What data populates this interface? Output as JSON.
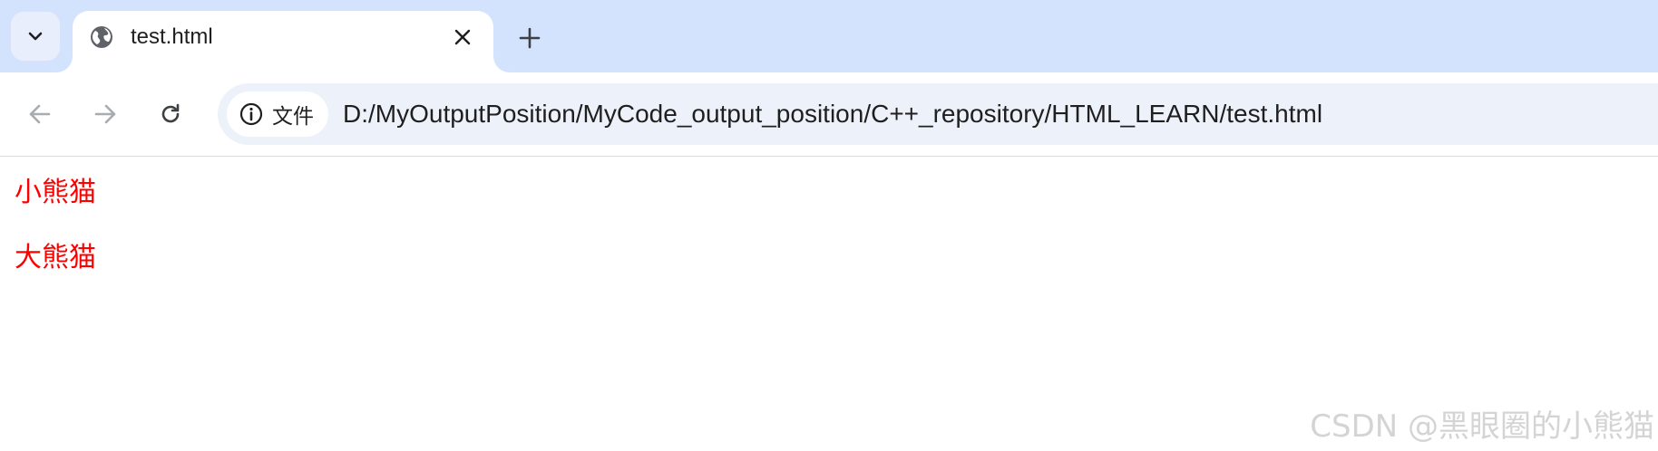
{
  "tabstrip": {
    "tab_search_icon": "chevron-down-icon",
    "active_tab": {
      "title": "test.html",
      "favicon": "globe-icon",
      "close_icon": "close-icon"
    },
    "new_tab_icon": "plus-icon",
    "background_color": "#d3e3fd"
  },
  "toolbar": {
    "back_icon": "arrow-left-icon",
    "forward_icon": "arrow-right-icon",
    "reload_icon": "reload-icon",
    "site_info": {
      "icon": "info-icon",
      "label": "文件"
    },
    "url": "D:/MyOutputPosition/MyCode_output_position/C++_repository/HTML_LEARN/test.html"
  },
  "page": {
    "lines": [
      "小熊猫",
      "大熊猫"
    ],
    "text_color": "#ff0000",
    "watermark": "CSDN @黑眼圈的小熊猫"
  }
}
